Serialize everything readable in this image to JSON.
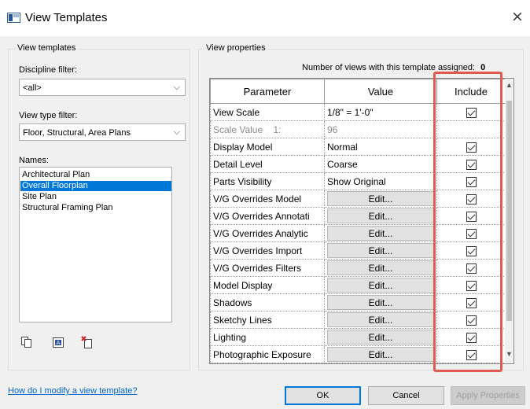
{
  "window": {
    "title": "View Templates",
    "close_glyph": "×",
    "icon": "view-templates-app-icon"
  },
  "left_panel": {
    "group_title": "View templates",
    "discipline_filter": {
      "label": "Discipline filter:",
      "value": "<all>"
    },
    "view_type_filter": {
      "label": "View type filter:",
      "value": "Floor, Structural, Area Plans"
    },
    "names": {
      "label": "Names:",
      "items": [
        "Architectural Plan",
        "Overall Floorplan",
        "Site Plan",
        "Structural Framing Plan"
      ],
      "selected_index": 1
    },
    "tools": [
      "duplicate-icon",
      "rename-icon",
      "delete-icon"
    ]
  },
  "right_panel": {
    "group_title": "View properties",
    "assigned_label": "Number of views with this template assigned:",
    "assigned_count": "0",
    "columns": [
      "Parameter",
      "Value",
      "Include"
    ],
    "rows": [
      {
        "parameter": "View Scale",
        "value": "1/8\" = 1'-0\"",
        "include": true
      },
      {
        "parameter": "Scale Value    1:",
        "value": "96",
        "include": false
      },
      {
        "parameter": "Display Model",
        "value": "Normal",
        "include": true
      },
      {
        "parameter": "Detail Level",
        "value": "Coarse",
        "include": true
      },
      {
        "parameter": "Parts Visibility",
        "value": "Show Original",
        "include": true
      },
      {
        "parameter": "V/G Overrides Model",
        "value": "Edit...",
        "include": true
      },
      {
        "parameter": "V/G Overrides Annotati",
        "value": "Edit...",
        "include": true
      },
      {
        "parameter": "V/G Overrides Analytic",
        "value": "Edit...",
        "include": true
      },
      {
        "parameter": "V/G Overrides Import",
        "value": "Edit...",
        "include": true
      },
      {
        "parameter": "V/G Overrides Filters",
        "value": "Edit...",
        "include": true
      },
      {
        "parameter": "Model Display",
        "value": "Edit...",
        "include": true
      },
      {
        "parameter": "Shadows",
        "value": "Edit...",
        "include": true
      },
      {
        "parameter": "Sketchy Lines",
        "value": "Edit...",
        "include": true
      },
      {
        "parameter": "Lighting",
        "value": "Edit...",
        "include": true
      },
      {
        "parameter": "Photographic Exposure",
        "value": "Edit...",
        "include": true
      }
    ],
    "highlight_color": "#e05a4f"
  },
  "footer": {
    "help_link": "How do I modify a view template?",
    "ok": "OK",
    "cancel": "Cancel",
    "apply": "Apply Properties"
  }
}
